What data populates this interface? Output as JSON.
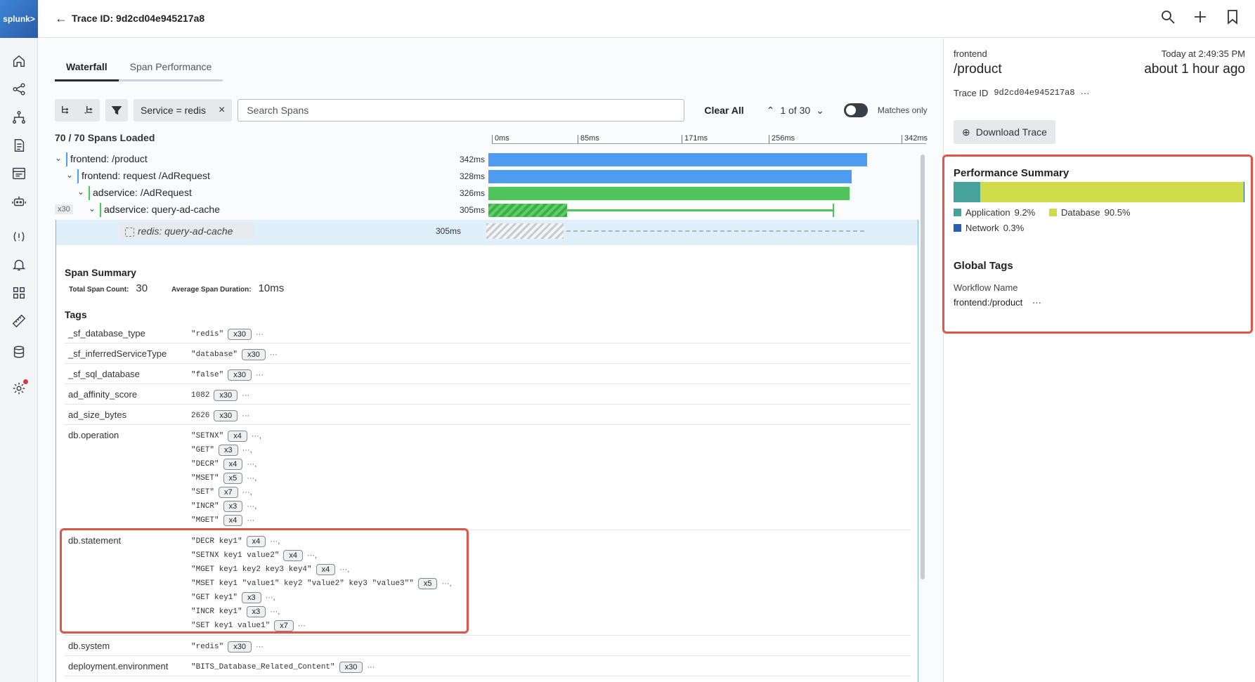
{
  "app": {
    "logo_text": "splunk>",
    "title": "Trace ID: 9d2cd04e945217a8"
  },
  "tabs": [
    {
      "label": "Waterfall"
    },
    {
      "label": "Span Performance"
    }
  ],
  "toolbar": {
    "filter_chip": "Service = redis",
    "search_placeholder": "Search Spans",
    "clear_all": "Clear All",
    "pager": "1 of 30",
    "matches_only": "Matches only"
  },
  "spans_loaded": "70 / 70 Spans Loaded",
  "axis_ticks": [
    "0ms",
    "85ms",
    "171ms",
    "256ms",
    "342ms"
  ],
  "spans": [
    {
      "service": "frontend:",
      "operation": " /product",
      "duration": "342ms",
      "color": "#4d9cef"
    },
    {
      "service": "frontend:",
      "operation": " request /AdRequest",
      "duration": "328ms",
      "color": "#4d9cef"
    },
    {
      "service": "adservice:",
      "operation": " /AdRequest",
      "duration": "326ms",
      "color": "#4fc45a"
    },
    {
      "service": "adservice:",
      "operation": " query-ad-cache",
      "duration": "305ms",
      "color": "#4fc45a",
      "badge": "x30"
    }
  ],
  "redis_span": {
    "label": "redis: query-ad-cache",
    "duration": "305ms"
  },
  "span_summary": {
    "title": "Span Summary",
    "total_label": "Total Span Count:",
    "total_value": "30",
    "avg_label": "Average Span Duration:",
    "avg_value": "10ms"
  },
  "tags_title": "Tags",
  "tags": [
    {
      "key": "_sf_database_type",
      "values": [
        {
          "v": "\"redis\"",
          "c": "x30",
          "d": "···"
        }
      ]
    },
    {
      "key": "_sf_inferredServiceType",
      "values": [
        {
          "v": "\"database\"",
          "c": "x30",
          "d": "···"
        }
      ]
    },
    {
      "key": "_sf_sql_database",
      "values": [
        {
          "v": "\"false\"",
          "c": "x30",
          "d": "···"
        }
      ]
    },
    {
      "key": "ad_affinity_score",
      "values": [
        {
          "v": "1082",
          "c": "x30",
          "d": "···"
        }
      ]
    },
    {
      "key": "ad_size_bytes",
      "values": [
        {
          "v": "2626",
          "c": "x30",
          "d": "···"
        }
      ]
    },
    {
      "key": "db.operation",
      "values": [
        {
          "v": "\"SETNX\"",
          "c": "x4",
          "d": "···,"
        },
        {
          "v": "\"GET\"",
          "c": "x3",
          "d": "···,"
        },
        {
          "v": "\"DECR\"",
          "c": "x4",
          "d": "···,"
        },
        {
          "v": "\"MSET\"",
          "c": "x5",
          "d": "···,"
        },
        {
          "v": "\"SET\"",
          "c": "x7",
          "d": "···,"
        },
        {
          "v": "\"INCR\"",
          "c": "x3",
          "d": "···,"
        },
        {
          "v": "\"MGET\"",
          "c": "x4",
          "d": "···"
        }
      ]
    },
    {
      "key": "db.statement",
      "values": [
        {
          "v": "\"DECR key1\"",
          "c": "x4",
          "d": "···,"
        },
        {
          "v": "\"SETNX key1 value2\"",
          "c": "x4",
          "d": "···,"
        },
        {
          "v": "\"MGET key1 key2 key3 key4\"",
          "c": "x4",
          "d": "···,"
        },
        {
          "v": "\"MSET key1 \"value1\" key2 \"value2\" key3 \"value3\"\"",
          "c": "x5",
          "d": "···,"
        },
        {
          "v": "\"GET key1\"",
          "c": "x3",
          "d": "···,"
        },
        {
          "v": "\"INCR key1\"",
          "c": "x3",
          "d": "···,"
        },
        {
          "v": "\"SET key1 value1\"",
          "c": "x7",
          "d": "···"
        }
      ]
    },
    {
      "key": "db.system",
      "values": [
        {
          "v": "\"redis\"",
          "c": "x30",
          "d": "···"
        }
      ]
    },
    {
      "key": "deployment.environment",
      "values": [
        {
          "v": "\"BITS_Database_Related_Content\"",
          "c": "x30",
          "d": "···"
        }
      ]
    }
  ],
  "right_panel": {
    "service": "frontend",
    "operation": "/product",
    "timestamp": "Today at 2:49:35 PM",
    "ago": "about 1 hour ago",
    "trace_id_label": "Trace ID",
    "trace_id": "9d2cd04e945217a8",
    "trace_id_more": "···",
    "download": "Download Trace",
    "perf_title": "Performance Summary",
    "perf": [
      {
        "name": "Application",
        "pct": "9.2%",
        "value": 9.2,
        "color": "#45a39c"
      },
      {
        "name": "Database",
        "pct": "90.5%",
        "value": 90.5,
        "color": "#cedc4a"
      },
      {
        "name": "Network",
        "pct": "0.3%",
        "value": 0.3,
        "color": "#2a5db8"
      }
    ],
    "global_tags_title": "Global Tags",
    "workflow_key": "Workflow Name",
    "workflow_value": "frontend:/product",
    "workflow_more": "···"
  }
}
